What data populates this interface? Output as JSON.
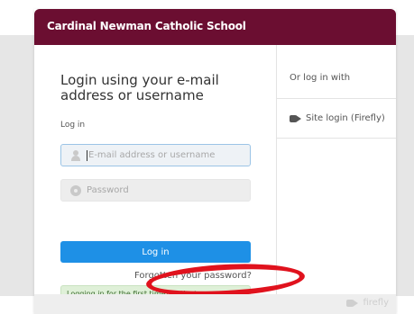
{
  "header": {
    "school_name": "Cardinal Newman Catholic School"
  },
  "login": {
    "title": "Login using your e-mail address or username",
    "section_label": "Log in",
    "email_placeholder": "E-mail address or username",
    "password_placeholder": "Password",
    "login_button": "Log in",
    "forgot_link": "Forgotten your password?",
    "first_time_notice": "Logging in for the first time? Activate your account."
  },
  "alt_login": {
    "heading": "Or log in with",
    "site_login": "Site login (Firefly)"
  },
  "footer": {
    "brand": "firefly"
  },
  "icons": {
    "email": "person-icon",
    "password": "lock-icon",
    "site_login": "firefly-icon",
    "footer": "firefly-logo-icon"
  },
  "colors": {
    "header_bg": "#6b0e31",
    "button_bg": "#1e90e6",
    "notice_bg": "#dff0d8",
    "annotation": "#e0121d"
  }
}
